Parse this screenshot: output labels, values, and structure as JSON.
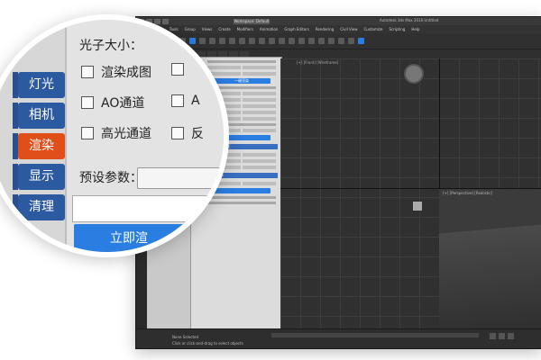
{
  "window": {
    "workspace": "Workspace: Default",
    "title": "Autodesk 3ds Max 2016   Untitled"
  },
  "menubar": [
    "Edit",
    "Tools",
    "Group",
    "Views",
    "Create",
    "Modifiers",
    "Animation",
    "Graph Editors",
    "Rendering",
    "Civil View",
    "Customize",
    "Scripting",
    "Help"
  ],
  "viewports": {
    "top_label": "[+] [Front] [Wireframe]",
    "persp_label": "[+] [Perspective] [Realistic]"
  },
  "plugin": {
    "tabs": [
      "灯光",
      "相机",
      "渲染",
      "显示",
      "清理"
    ],
    "active_tab": "渲染",
    "render_button": "一键渲染",
    "section_headers": [
      "Gamma校正",
      "切换显示"
    ]
  },
  "status": {
    "line1": "None Selected",
    "line2": "Click or click-and-drag to select objects"
  },
  "magnifier": {
    "tabs": [
      {
        "label": "灯光"
      },
      {
        "label": "相机"
      },
      {
        "label": "渲染",
        "active": true
      },
      {
        "label": "显示"
      },
      {
        "label": "清理"
      }
    ],
    "top_text": "光子大小：",
    "checkboxes": [
      {
        "label": "渲染成图"
      },
      {
        "label": "AO通道"
      },
      {
        "label": "A"
      },
      {
        "label": "高光通道"
      },
      {
        "label": "反"
      }
    ],
    "preset_label": "预设参数：",
    "button_label": "立即渲"
  }
}
